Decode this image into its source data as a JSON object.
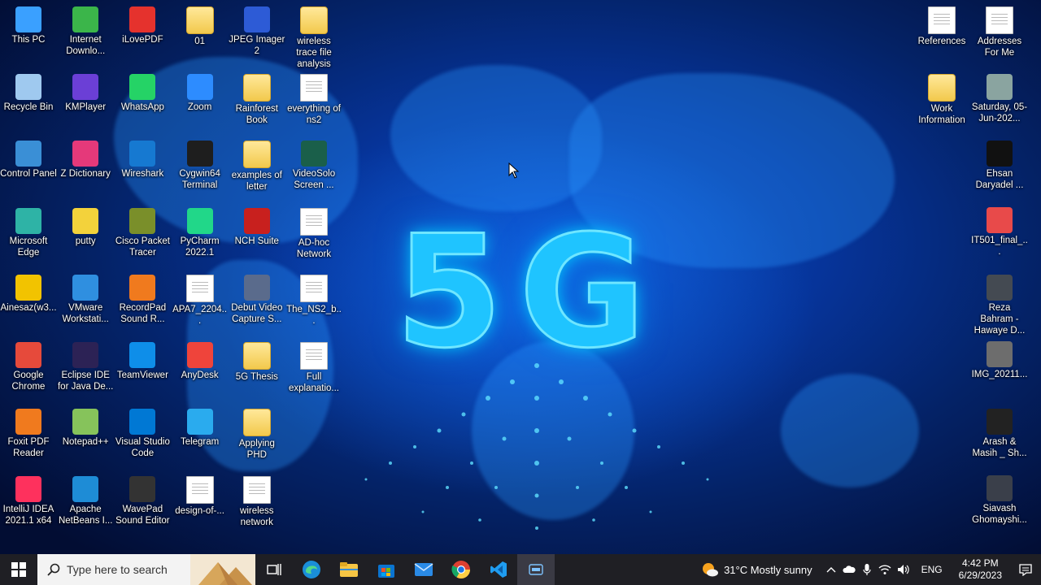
{
  "desktop": {
    "wallpaper_text": "5G",
    "icons_left": [
      {
        "label": "This PC",
        "icon": "computer-icon",
        "color": "#3aa0ff"
      },
      {
        "label": "Recycle Bin",
        "icon": "recycle-bin-icon",
        "color": "#9fc9ef"
      },
      {
        "label": "Control Panel",
        "icon": "control-panel-icon",
        "color": "#3a8fd6"
      },
      {
        "label": "Microsoft Edge",
        "icon": "edge-icon",
        "color": "#2eb3a6"
      },
      {
        "label": "Ainesaz(w3...",
        "icon": "help-icon",
        "color": "#f2c300"
      },
      {
        "label": "Google Chrome",
        "icon": "chrome-icon",
        "color": "#e64a3b"
      },
      {
        "label": "Foxit PDF Reader",
        "icon": "foxit-icon",
        "color": "#f07a1e"
      },
      {
        "label": "IntelliJ IDEA 2021.1 x64",
        "icon": "intellij-icon",
        "color": "#fe315d"
      },
      {
        "label": "Internet Downlo...",
        "icon": "idm-icon",
        "color": "#3bb54a"
      },
      {
        "label": "KMPlayer",
        "icon": "kmplayer-icon",
        "color": "#6b3fd6"
      },
      {
        "label": "Z Dictionary",
        "icon": "dictionary-icon",
        "color": "#e5397a"
      },
      {
        "label": "putty",
        "icon": "putty-icon",
        "color": "#f3d23b"
      },
      {
        "label": "VMware Workstati...",
        "icon": "vmware-icon",
        "color": "#2f8fe0"
      },
      {
        "label": "Eclipse IDE for Java De...",
        "icon": "eclipse-icon",
        "color": "#2c2255"
      },
      {
        "label": "Notepad++",
        "icon": "notepad-icon",
        "color": "#86c35b"
      },
      {
        "label": "Apache NetBeans I...",
        "icon": "netbeans-icon",
        "color": "#1e8cd6"
      },
      {
        "label": "iLovePDF",
        "icon": "ilovepdf-icon",
        "color": "#e5322d"
      },
      {
        "label": "WhatsApp",
        "icon": "whatsapp-icon",
        "color": "#25d366"
      },
      {
        "label": "Wireshark",
        "icon": "wireshark-icon",
        "color": "#1679d1"
      },
      {
        "label": "Cisco Packet Tracer",
        "icon": "packet-tracer-icon",
        "color": "#7a8f2a"
      },
      {
        "label": "RecordPad Sound R...",
        "icon": "recordpad-icon",
        "color": "#f07a1e"
      },
      {
        "label": "TeamViewer",
        "icon": "teamviewer-icon",
        "color": "#0e8ee9"
      },
      {
        "label": "Visual Studio Code",
        "icon": "vscode-icon",
        "color": "#0078d4"
      },
      {
        "label": "WavePad Sound Editor",
        "icon": "wavepad-icon",
        "color": "#333333"
      },
      {
        "label": "01",
        "icon": "folder-icon",
        "type": "folder"
      },
      {
        "label": "Zoom",
        "icon": "zoom-icon",
        "color": "#2d8cff"
      },
      {
        "label": "Cygwin64 Terminal",
        "icon": "cygwin-icon",
        "color": "#1e1e1e"
      },
      {
        "label": "PyCharm 2022.1",
        "icon": "pycharm-icon",
        "color": "#21d789"
      },
      {
        "label": "APA7_2204...",
        "icon": "document-icon",
        "type": "doc"
      },
      {
        "label": "AnyDesk",
        "icon": "anydesk-icon",
        "color": "#ef443b"
      },
      {
        "label": "Telegram",
        "icon": "telegram-icon",
        "color": "#2aabee"
      },
      {
        "label": "design-of-...",
        "icon": "document-icon",
        "type": "doc"
      },
      {
        "label": "JPEG Imager 2",
        "icon": "jpeg-imager-icon",
        "color": "#2d5bd6"
      },
      {
        "label": "Rainforest Book",
        "icon": "folder-icon",
        "type": "folder"
      },
      {
        "label": "examples of letter",
        "icon": "folder-icon",
        "type": "folder"
      },
      {
        "label": "NCH Suite",
        "icon": "nch-icon",
        "color": "#c8201e"
      },
      {
        "label": "Debut Video Capture S...",
        "icon": "debut-icon",
        "color": "#5a6b8c"
      },
      {
        "label": "5G Thesis",
        "icon": "folder-icon",
        "type": "folder"
      },
      {
        "label": "Applying PHD",
        "icon": "folder-icon",
        "type": "folder"
      },
      {
        "label": "wireless network",
        "icon": "document-icon",
        "type": "doc"
      },
      {
        "label": "wireless trace file analysis",
        "icon": "folder-icon",
        "type": "folder"
      },
      {
        "label": "everything of ns2",
        "icon": "document-icon",
        "type": "doc"
      },
      {
        "label": "VideoSolo Screen ...",
        "icon": "videosolo-icon",
        "color": "#1a5f4a"
      },
      {
        "label": "AD-hoc Network",
        "icon": "document-icon",
        "type": "doc"
      },
      {
        "label": "The_NS2_b...",
        "icon": "document-icon",
        "type": "doc"
      },
      {
        "label": "Full explanatio...",
        "icon": "document-icon",
        "type": "doc"
      }
    ],
    "icons_right": [
      {
        "label": "References",
        "icon": "document-icon",
        "type": "doc"
      },
      {
        "label": "Addresses For Me",
        "icon": "document-icon",
        "type": "doc"
      },
      {
        "label": "Work Information",
        "icon": "folder-icon",
        "type": "folder"
      },
      {
        "label": "Saturday, 05-Jun-202...",
        "icon": "image-icon",
        "color": "#8aa4a0"
      },
      {
        "label": "Ehsan Daryadel ...",
        "icon": "image-icon",
        "color": "#111111"
      },
      {
        "label": "IT501_final_...",
        "icon": "image-icon",
        "color": "#e84a4a"
      },
      {
        "label": "Reza Bahram - Hawaye D...",
        "icon": "image-icon",
        "color": "#444a52"
      },
      {
        "label": "IMG_20211...",
        "icon": "image-icon",
        "color": "#6d6d6d"
      },
      {
        "label": "Arash & Masih _ Sh...",
        "icon": "image-icon",
        "color": "#222222"
      },
      {
        "label": "Siavash Ghomayshi...",
        "icon": "image-icon",
        "color": "#3a3f4a"
      }
    ]
  },
  "taskbar": {
    "search_placeholder": "Type here to search",
    "weather": "31°C  Mostly sunny",
    "language": "ENG",
    "time": "4:42 PM",
    "date": "6/29/2023"
  }
}
